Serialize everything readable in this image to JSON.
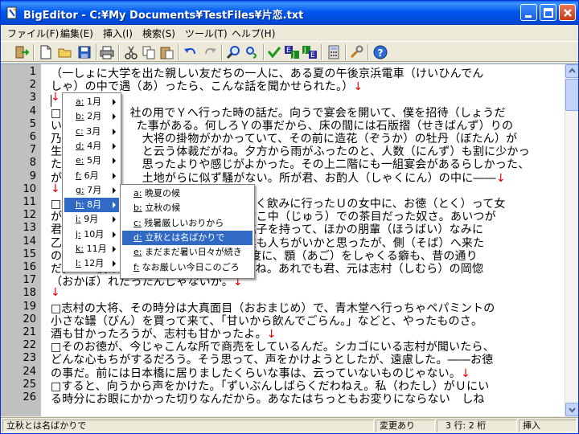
{
  "window": {
    "title": "BigEditor - C:¥My Documents¥TestFiles¥片恋.txt"
  },
  "menubar": {
    "items": [
      "ファイル(F)",
      "編集(E)",
      "挿入(I)",
      "検索(S)",
      "ツール(T)",
      "ヘルプ(H)"
    ]
  },
  "toolbar": {
    "icons": [
      "exit-icon",
      "new-file-icon",
      "open-folder-icon",
      "save-icon",
      "print-icon",
      "cut-icon",
      "copy-icon",
      "paste-icon",
      "undo-icon",
      "redo-icon",
      "find-icon",
      "replace-icon",
      "check-icon",
      "convert-ej-icon",
      "convert-je-icon",
      "calculator-icon",
      "tools-icon",
      "help-icon"
    ]
  },
  "editor": {
    "line_numbers": [
      "1",
      "2",
      "3",
      "4",
      "5",
      "6",
      "7",
      "8",
      "9",
      "10",
      "11",
      "12",
      "13",
      "14",
      "15",
      "16",
      "17",
      "18",
      "19",
      "20",
      "21",
      "22",
      "23",
      "24",
      "25",
      "26"
    ],
    "rows": [
      {
        "text": "（一しょに大学を出た親しい友だちの一人に、ある夏の午後京浜電車（けいひんでん",
        "ret": false
      },
      {
        "text": "しゃ）の中で遇（あ）ったら、こんな話を聞かせられた。）",
        "ret": true
      },
      {
        "text": "",
        "ret": true
      },
      {
        "text": "□　　　　　　社の用でＹへ行った時の話だ。向うで宴会を開いて、僕を招待（しょうだ",
        "ret": false
      },
      {
        "text": "い）　　　　　　た事がある。何しろＹの事だから、床の間には石版摺（せきばんず）りの",
        "ret": false
      },
      {
        "text": "乃　　　　　　　大将の掛物がかかっていて、その前に造花（ぞうか）の牡丹（ぼたん）が",
        "ret": false
      },
      {
        "text": "生　　　　　　　と云う体裁だがね。夕方から雨がふったのと、人数（にんず）も割に少かっ",
        "ret": false
      },
      {
        "text": "た　　　　　　　思ったよりや感じがよかった。その上二階にも一組宴会があるらしかった、",
        "ret": false
      },
      {
        "text": "が　　　　　　　土地がらに似ず騒がない。所が君、お酌人（しゃくにん）の中に――",
        "ret": true
      },
      {
        "text": "",
        "ret": true
      },
      {
        "text": "□　　　　　　　　　　　　　　　　よく飲みに行ったＵの女中に、お徳（とく）って女",
        "ret": false
      },
      {
        "text": "が　　　　　　　　　　　　　　　あすこ中（じゅう）での茶目だった奴さ。あいつが",
        "ret": false
      },
      {
        "text": "君　　　　　　　　　　　　　　　お銚子を持って、ほかの朋輩（ほうばい）なみに",
        "ret": false
      },
      {
        "text": "乙　　　　　　　　　　　　　　　は僕も人ちがいかと思ったが、側（そば）へ来た",
        "ret": false
      },
      {
        "text": "のを見ると、　　　　　　　　　の云う度に、顋（あご）をしゃくる癖も、昔の通り",
        "ret": false
      },
      {
        "text": "だ。――僕は実際無常を感じてしまったね。あれでも君、元は志村（しむら）の岡惚",
        "ret": false
      },
      {
        "text": "（おかぼ）れだったんじゃないか。",
        "ret": true
      },
      {
        "text": "",
        "ret": true
      },
      {
        "text": "□志村の大将、その時分は大真面目（おおまじめ）で、青木堂へ行っちゃペパミントの",
        "ret": false
      },
      {
        "text": "小さな罎（びん）を買って来て、「甘いから飲んでごらん。」などと、やったものさ。",
        "ret": false
      },
      {
        "text": "酒も甘かったろうが、志村も甘かったよ。",
        "ret": true
      },
      {
        "text": "□そのお徳が、今じゃこんな所で商売をしているんだ。シカゴにいる志村が聞いたら、",
        "ret": false
      },
      {
        "text": "どんな心もちがするだろう。そう思って、声をかけようとしたが、遠慮した。――お徳",
        "ret": false
      },
      {
        "text": "の事だ。前には日本橋に居りましたくらいな事は、云っていないものじゃない。",
        "ret": true
      },
      {
        "text": "□すると、向うから声をかけた。「ずいぶんしばらくだわねえ。私（わたし）がＵにい",
        "ret": false
      },
      {
        "text": "る時分にお眼にかかった切りなんだから。あなたはちっともお変りにならない　しね",
        "ret": false
      }
    ]
  },
  "month_menu": {
    "items": [
      {
        "key": "a:",
        "label": " 1月",
        "selected": false
      },
      {
        "key": "b:",
        "label": " 2月",
        "selected": false
      },
      {
        "key": "c:",
        "label": " 3月",
        "selected": false
      },
      {
        "key": "d:",
        "label": " 4月",
        "selected": false
      },
      {
        "key": "e:",
        "label": " 5月",
        "selected": false
      },
      {
        "key": "f:",
        "label": " 6月",
        "selected": false
      },
      {
        "key": "g:",
        "label": " 7月",
        "selected": false
      },
      {
        "key": "h:",
        "label": " 8月",
        "selected": true
      },
      {
        "key": "i:",
        "label": " 9月",
        "selected": false
      },
      {
        "key": "j:",
        "label": " 10月",
        "selected": false
      },
      {
        "key": "k:",
        "label": " 11月",
        "selected": false
      },
      {
        "key": "l:",
        "label": " 12月",
        "selected": false
      }
    ]
  },
  "greeting_menu": {
    "items": [
      {
        "key": "a:",
        "label": " 晩夏の候",
        "selected": false
      },
      {
        "key": "b:",
        "label": " 立秋の候",
        "selected": false
      },
      {
        "key": "c:",
        "label": " 残暑厳しいおりから",
        "selected": false
      },
      {
        "key": "d:",
        "label": " 立秋とは名ばかりで",
        "selected": true
      },
      {
        "key": "e:",
        "label": " まだまだ暑い日々が続き",
        "selected": false
      },
      {
        "key": "f:",
        "label": " なお厳しい今日このごろ",
        "selected": false
      }
    ]
  },
  "statusbar": {
    "message": "立秋とは名ばかりで",
    "modified": "変更あり",
    "position": "3 行: 2 桁",
    "mode": "挿入"
  },
  "colors": {
    "title_bar": "#0058ee",
    "selection": "#316ac5",
    "return_mark": "#e00000",
    "gutter": "#c0c0c0"
  }
}
